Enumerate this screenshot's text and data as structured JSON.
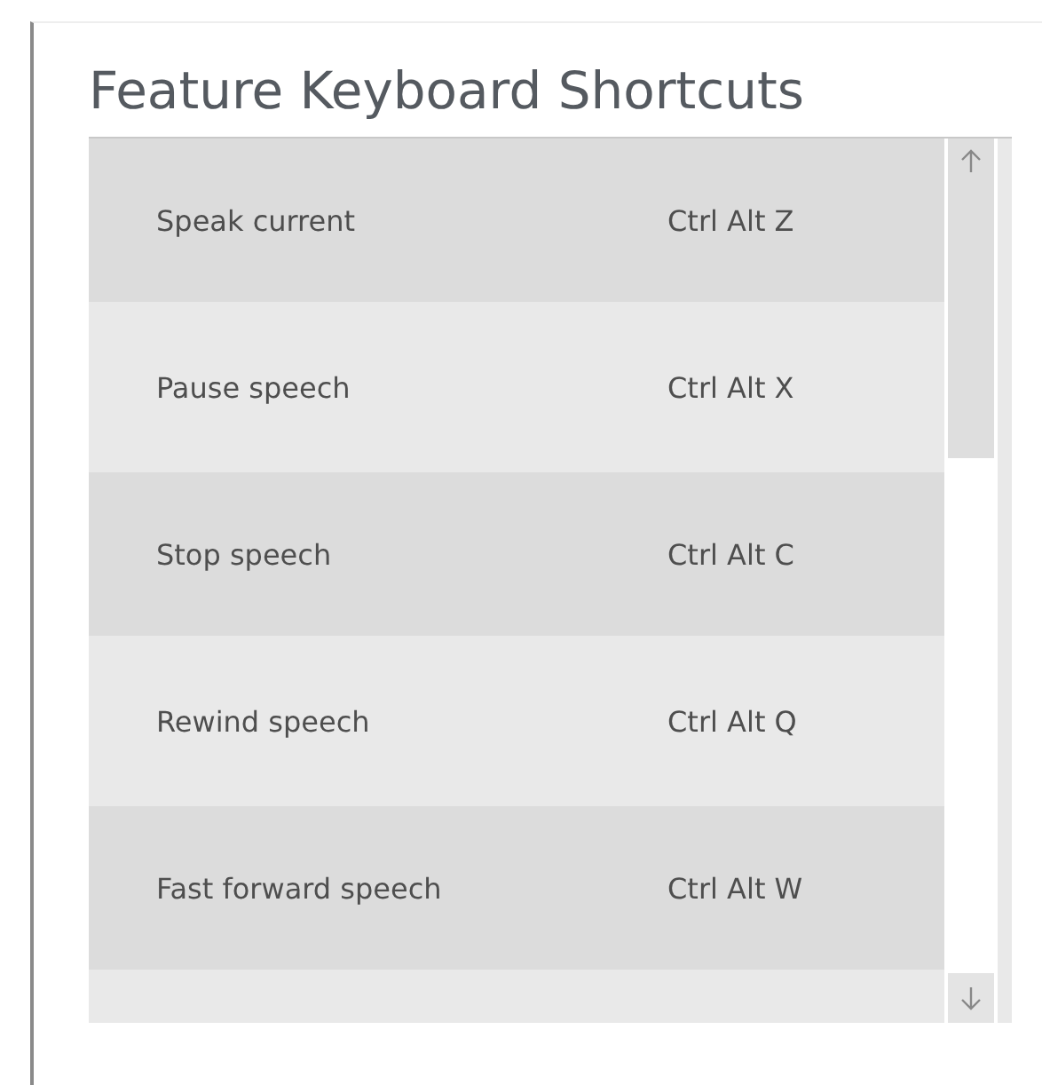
{
  "title": "Feature Keyboard Shortcuts",
  "shortcuts": [
    {
      "action": "Speak current",
      "keys": "Ctrl Alt Z"
    },
    {
      "action": "Pause speech",
      "keys": "Ctrl Alt X"
    },
    {
      "action": "Stop speech",
      "keys": "Ctrl Alt C"
    },
    {
      "action": "Rewind speech",
      "keys": "Ctrl Alt Q"
    },
    {
      "action": "Fast forward speech",
      "keys": "Ctrl Alt W"
    }
  ]
}
